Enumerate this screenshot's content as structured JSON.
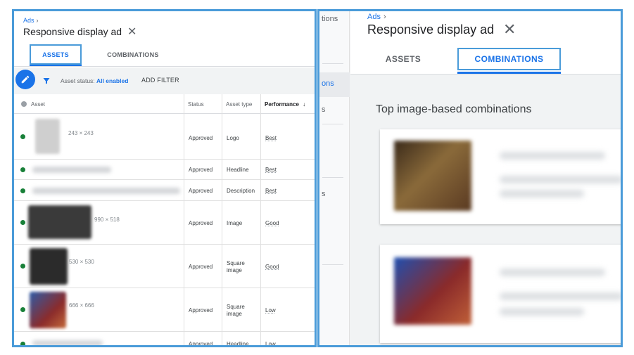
{
  "left": {
    "breadcrumb": "Ads",
    "breadcrumb_sep": "›",
    "title": "Responsive display ad",
    "close_glyph": "✕",
    "tabs": {
      "assets": "ASSETS",
      "combinations": "COMBINATIONS"
    },
    "active_tab": "assets",
    "filter": {
      "status_label": "Asset status:",
      "status_value": "All enabled",
      "add_filter": "ADD FILTER"
    },
    "columns": {
      "asset": "Asset",
      "status": "Status",
      "type": "Asset type",
      "performance": "Performance",
      "sort_glyph": "↓"
    },
    "rows": [
      {
        "dim": "243 × 243",
        "status": "Approved",
        "type": "Logo",
        "performance": "Best"
      },
      {
        "dim": "",
        "status": "Approved",
        "type": "Headline",
        "performance": "Best"
      },
      {
        "dim": "",
        "status": "Approved",
        "type": "Description",
        "performance": "Best"
      },
      {
        "dim": "990 × 518",
        "status": "Approved",
        "type": "Image",
        "performance": "Good"
      },
      {
        "dim": "530 × 530",
        "status": "Approved",
        "type": "Square image",
        "performance": "Good"
      },
      {
        "dim": "666 × 666",
        "status": "Approved",
        "type": "Square image",
        "performance": "Low"
      },
      {
        "dim": "",
        "status": "Approved",
        "type": "Headline",
        "performance": "Low"
      }
    ]
  },
  "right": {
    "sidebar": {
      "item1": "tions",
      "item2": "ons",
      "item3": "s",
      "item4": "s"
    },
    "breadcrumb": "Ads",
    "breadcrumb_sep": "›",
    "title": "Responsive display ad",
    "close_glyph": "✕",
    "tabs": {
      "assets": "ASSETS",
      "combinations": "COMBINATIONS"
    },
    "active_tab": "combinations",
    "section_title": "Top image-based combinations"
  },
  "colors": {
    "accent": "#1a73e8",
    "highlight_border": "#4a9bd9",
    "status_green": "#188038"
  },
  "icons": [
    "close-icon",
    "edit-icon",
    "filter-icon",
    "sort-down-icon",
    "status-dot-icon"
  ]
}
